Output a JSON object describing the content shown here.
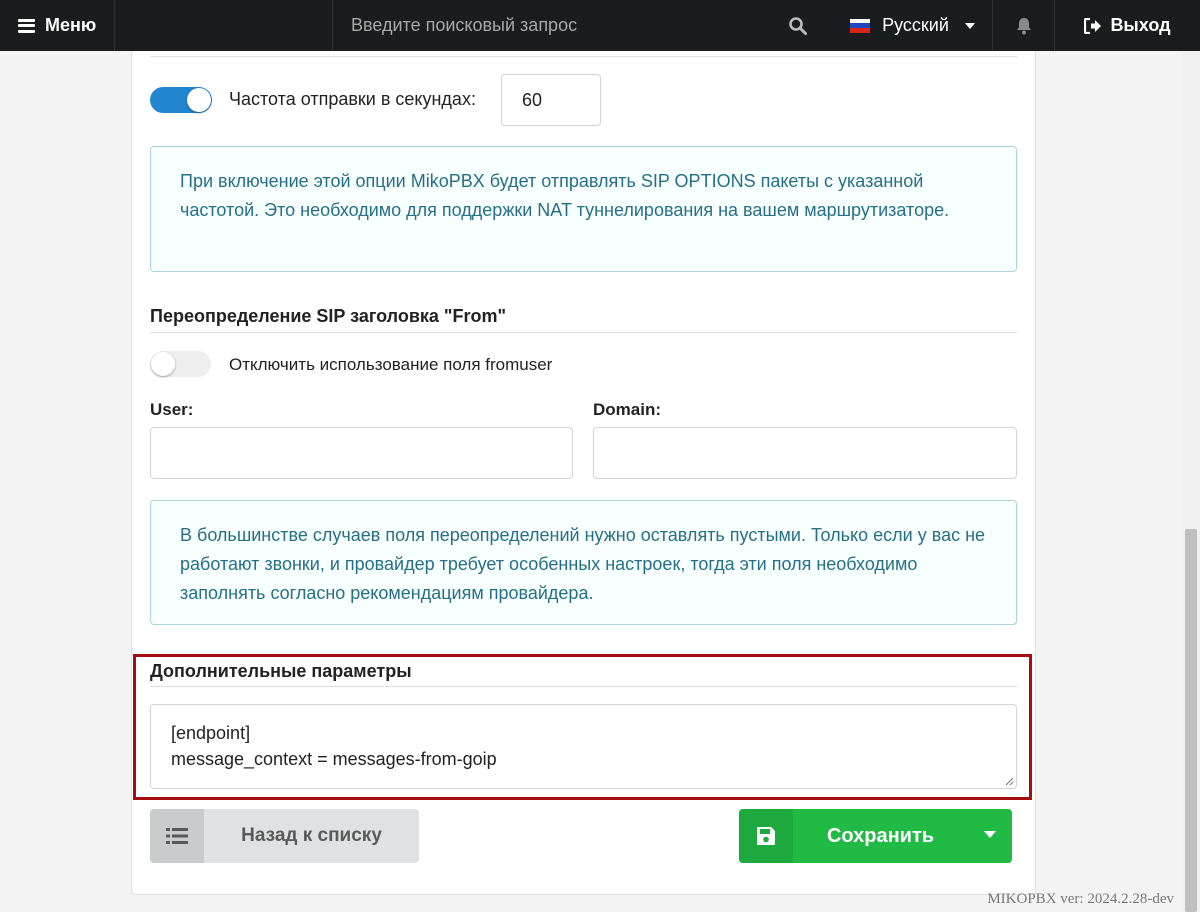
{
  "topbar": {
    "menu_label": "Меню",
    "search_placeholder": "Введите поисковый запрос",
    "language": "Русский",
    "logout_label": "Выход"
  },
  "nat": {
    "toggle_on": true,
    "frequency_label": "Частота отправки в секундах:",
    "frequency_value": "60",
    "info_text": "При включение этой опции MikoPBX будет отправлять SIP OPTIONS пакеты с указанной частотой. Это необходимо для поддержки NAT туннелирования на вашем маршрутизаторе."
  },
  "from_override": {
    "title": "Переопределение SIP заголовка \"From\"",
    "toggle_on": false,
    "toggle_label": "Отключить использование поля fromuser",
    "user_label": "User:",
    "user_value": "",
    "domain_label": "Domain:",
    "domain_value": "",
    "info_text": "В большинстве случаев поля переопределений нужно оставлять пустыми. Только если у вас не работают звонки, и провайдер требует особенных настроек, тогда эти поля необходимо заполнять согласно рекомендациям провайдера."
  },
  "additional": {
    "title": "Дополнительные параметры",
    "value": "[endpoint]\nmessage_context = messages-from-goip"
  },
  "buttons": {
    "back_label": "Назад к списку",
    "save_label": "Сохранить"
  },
  "version": "MIKOPBX ver: 2024.2.28-dev",
  "colors": {
    "accent": "#2185d0",
    "save": "#21ba45",
    "highlight": "#a50e0e",
    "info_text": "#276f86"
  }
}
